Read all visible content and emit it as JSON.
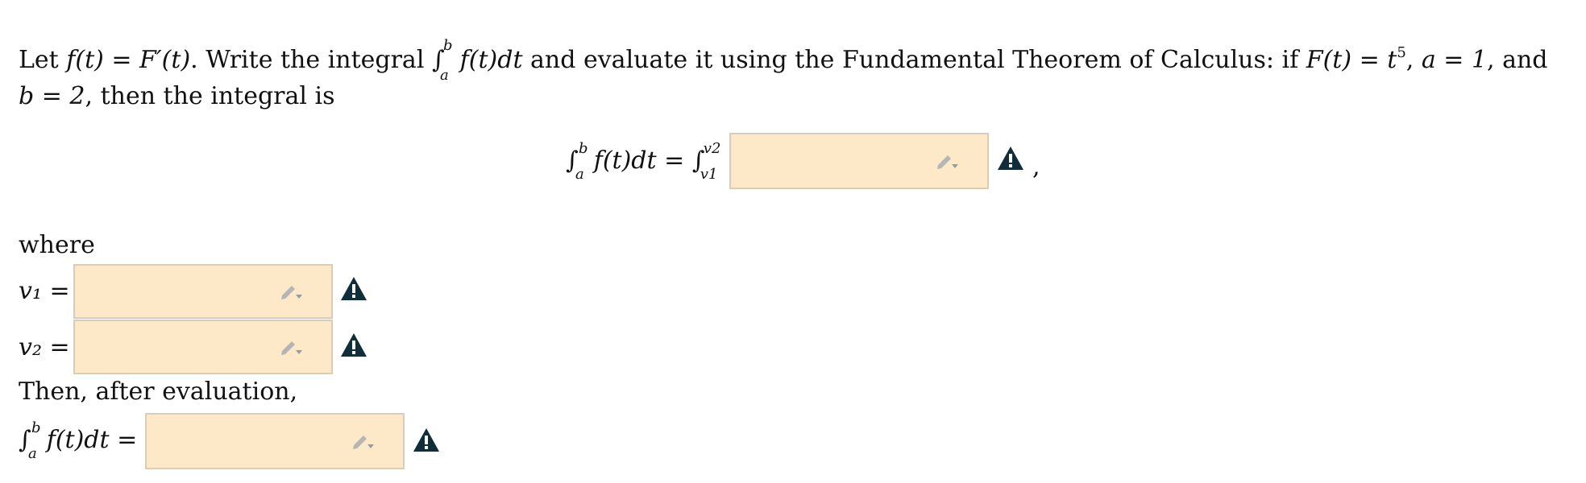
{
  "prompt": {
    "text_1": "Let ",
    "text_2": ". Write the integral ",
    "text_3": " and evaluate it using the Fundamental Theorem of Calculus: if ",
    "text_4": ", ",
    "text_5": ", and ",
    "text_6": ", then the integral is",
    "f_def": "f(t) = F′(t)",
    "integrand": "f(t)dt",
    "F_def_base": "F(t) = t",
    "F_exponent": "5",
    "a_def": "a = 1",
    "b_def": "b = 2",
    "lower_limit": "a",
    "upper_limit": "b",
    "integral_sign": "∫"
  },
  "equation_main": {
    "integral_sign": "∫",
    "upper": "b",
    "lower": "a",
    "lhs_integrand": "f(t)dt",
    "equals": "=",
    "rhs_integral_sign": "∫",
    "rhs_upper": "v2",
    "rhs_lower": "v1",
    "trailing": ","
  },
  "where_label": "where",
  "v1_label": "v₁ =",
  "v2_label": "v₂ =",
  "then_label": "Then, after evaluation,",
  "final_eq": {
    "integral_sign": "∫",
    "upper": "b",
    "lower": "a",
    "integrand": "f(t)dt",
    "equals": "="
  },
  "fields": {
    "integrand_value": "",
    "v1_value": "",
    "v2_value": "",
    "result_value": ""
  },
  "icons": {
    "edit": "pencil-dropdown-icon",
    "warning": "warning-triangle-icon"
  },
  "colors": {
    "field_bg": "#fde8c8",
    "field_border": "#d9ccb8",
    "warning": "#0f2e3a",
    "pencil": "#b5b5b5"
  }
}
